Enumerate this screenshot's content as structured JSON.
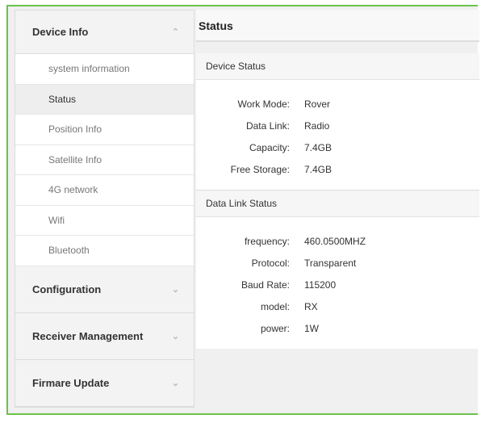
{
  "sidebar": {
    "groups": [
      {
        "label": "Device Info",
        "chevron": "chevron-up-icon"
      },
      {
        "label": "Configuration",
        "chevron": "chevron-down-icon"
      },
      {
        "label": "Receiver Management",
        "chevron": "chevron-down-icon"
      },
      {
        "label": "Firmare Update",
        "chevron": "chevron-down-icon"
      }
    ],
    "device_info_items": [
      {
        "label": "system information"
      },
      {
        "label": "Status"
      },
      {
        "label": "Position Info"
      },
      {
        "label": "Satellite Info"
      },
      {
        "label": "4G network"
      },
      {
        "label": "Wifi"
      },
      {
        "label": "Bluetooth"
      }
    ]
  },
  "main": {
    "title": "Status",
    "device_status": {
      "heading": "Device Status",
      "rows": [
        {
          "label": "Work Mode:",
          "value": "Rover"
        },
        {
          "label": "Data Link:",
          "value": "Radio"
        },
        {
          "label": "Capacity:",
          "value": "7.4GB"
        },
        {
          "label": "Free Storage:",
          "value": "7.4GB"
        }
      ]
    },
    "data_link_status": {
      "heading": "Data Link Status",
      "rows": [
        {
          "label": "frequency:",
          "value": "460.0500MHZ"
        },
        {
          "label": "Protocol:",
          "value": "Transparent"
        },
        {
          "label": "Baud Rate:",
          "value": "115200"
        },
        {
          "label": "model:",
          "value": "RX"
        },
        {
          "label": "power:",
          "value": "1W"
        }
      ]
    }
  },
  "colors": {
    "frame_border": "#6cc24a",
    "active_item_bg": "#eeeeee"
  }
}
